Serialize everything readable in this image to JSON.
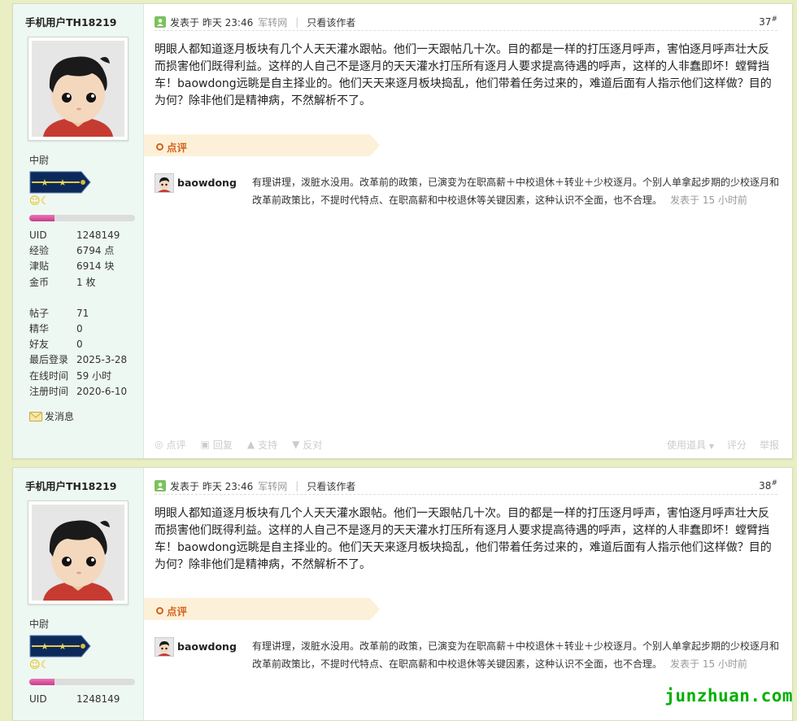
{
  "watermark": "junzhuan.com",
  "posts": [
    {
      "username": "手机用户TH18219",
      "rank": "中尉",
      "stats": [
        {
          "key": "UID",
          "value": "1248149"
        },
        {
          "key": "经验",
          "value": "6794 点"
        },
        {
          "key": "津贴",
          "value": "6914 块"
        },
        {
          "key": "金币",
          "value": "1 枚"
        }
      ],
      "stats2": [
        {
          "key": "帖子",
          "value": "71"
        },
        {
          "key": "精华",
          "value": "0"
        },
        {
          "key": "好友",
          "value": "0"
        },
        {
          "key": "最后登录",
          "value": "2025-3-28"
        },
        {
          "key": "在线时间",
          "value": "59 小时"
        },
        {
          "key": "注册时间",
          "value": "2020-6-10"
        }
      ],
      "message_label": "发消息",
      "posted_label": "发表于",
      "posted_time": "昨天 23:46",
      "source": "军转网",
      "only_author": "只看该作者",
      "floor": "37",
      "body": "明眼人都知道逐月板块有几个人天天灌水跟帖。他们一天跟帖几十次。目的都是一样的打压逐月呼声，害怕逐月呼声壮大反而损害他们既得利益。这样的人自己不是逐月的天天灌水打压所有逐月人要求提高待遇的呼声，这样的人非蠢即坏！螳臂挡车！baowdong远眺是自主择业的。他们天天来逐月板块捣乱，他们带着任务过来的，难道后面有人指示他们这样做？目的为何？除非他们是精神病，不然解析不了。",
      "review_label": "点评",
      "comment": {
        "author": "baowdong",
        "text": "有理讲理，泼脏水没用。改革前的政策，已演变为在职高薪＋中校退休＋转业＋少校逐月。个别人单拿起步期的少校逐月和改革前政策比，不提时代特点、在职高薪和中校退休等关键因素，这种认识不全面，也不合理。",
        "time": "发表于 15 小时前"
      },
      "footer": {
        "review": "点评",
        "reply": "回复",
        "support": "支持",
        "oppose": "反对",
        "tools": "使用道具",
        "rate": "评分",
        "report": "举报"
      }
    },
    {
      "username": "手机用户TH18219",
      "rank": "中尉",
      "stats": [
        {
          "key": "UID",
          "value": "1248149"
        }
      ],
      "posted_label": "发表于",
      "posted_time": "昨天 23:46",
      "source": "军转网",
      "only_author": "只看该作者",
      "floor": "38",
      "body": "明眼人都知道逐月板块有几个人天天灌水跟帖。他们一天跟帖几十次。目的都是一样的打压逐月呼声，害怕逐月呼声壮大反而损害他们既得利益。这样的人自己不是逐月的天天灌水打压所有逐月人要求提高待遇的呼声，这样的人非蠢即坏！螳臂挡车！baowdong远眺是自主择业的。他们天天来逐月板块捣乱，他们带着任务过来的，难道后面有人指示他们这样做？目的为何？除非他们是精神病，不然解析不了。",
      "review_label": "点评",
      "comment": {
        "author": "baowdong",
        "text": "有理讲理，泼脏水没用。改革前的政策，已演变为在职高薪＋中校退休＋转业＋少校逐月。个别人单拿起步期的少校逐月和改革前政策比，不提时代特点、在职高薪和中校退休等关键因素，这种认识不全面，也不合理。",
        "time": "发表于 15 小时前"
      }
    }
  ]
}
